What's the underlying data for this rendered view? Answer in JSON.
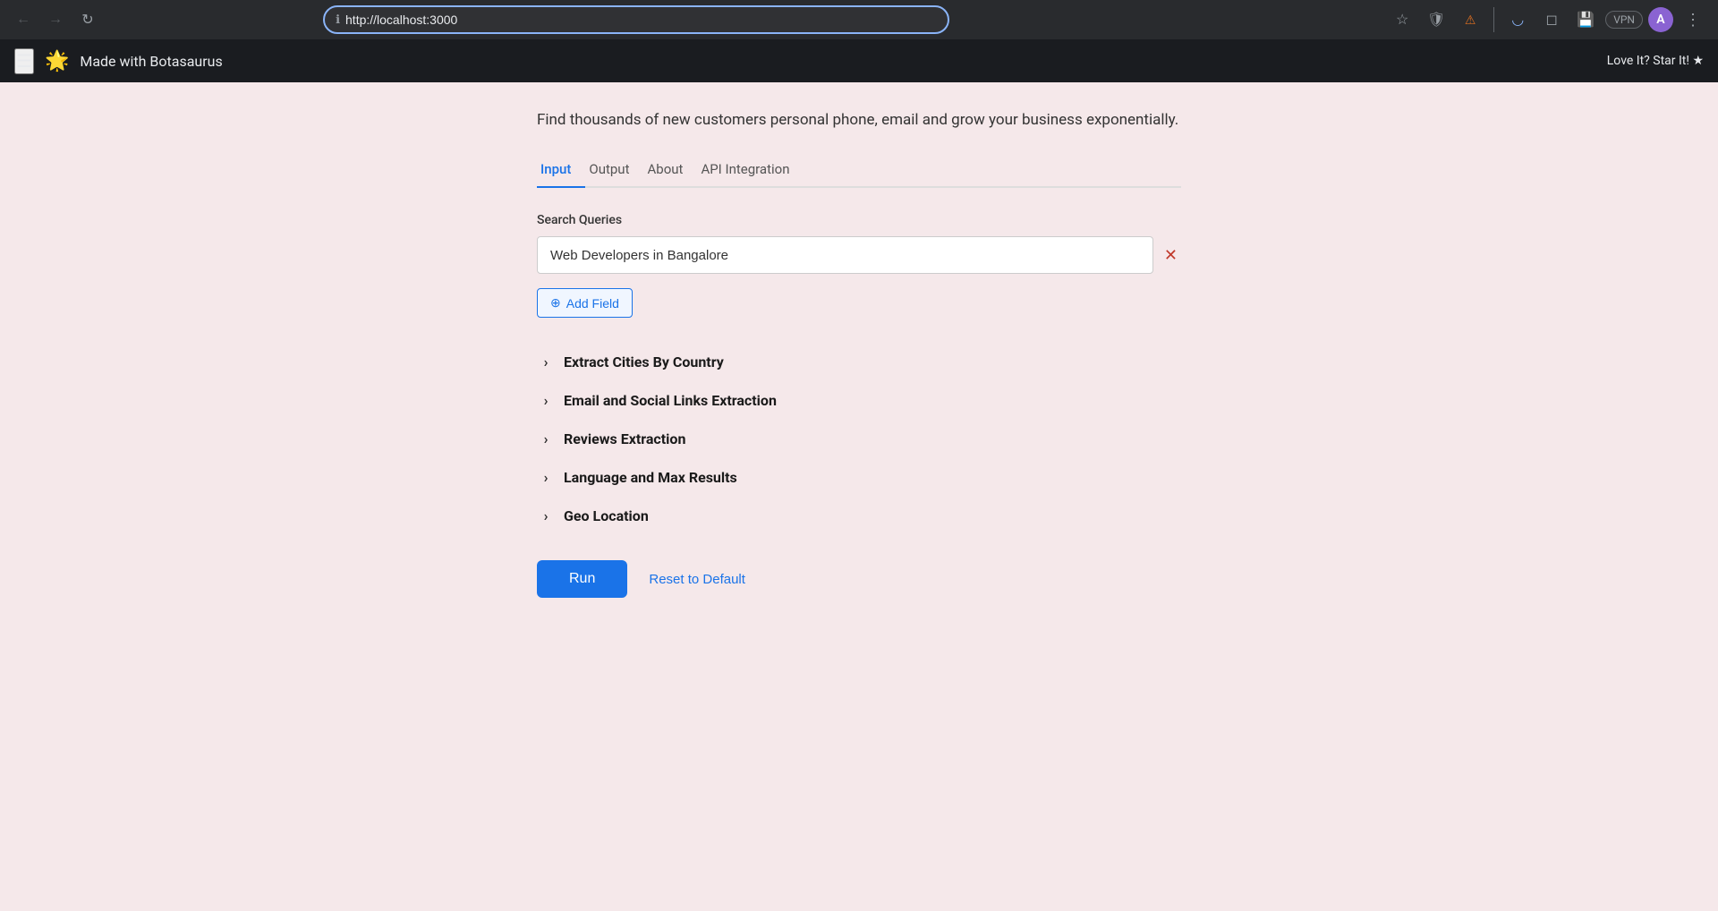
{
  "browser": {
    "url": "http://localhost:3000",
    "back_disabled": true,
    "forward_disabled": true
  },
  "app_header": {
    "title": "Made with Botasaurus",
    "logo_emoji": "🌟",
    "cta": "Love It? Star It! ★"
  },
  "tagline": "Find thousands of new customers personal phone, email and grow your business exponentially.",
  "tabs": [
    {
      "label": "Input",
      "active": true
    },
    {
      "label": "Output",
      "active": false
    },
    {
      "label": "About",
      "active": false
    },
    {
      "label": "API Integration",
      "active": false
    }
  ],
  "search_queries": {
    "label": "Search Queries",
    "placeholder": "Web Developers in Bangalore",
    "value": "Web Developers in Bangalore"
  },
  "add_field_btn": "+ Add Field",
  "accordion_sections": [
    {
      "title": "Extract Cities By Country"
    },
    {
      "title": "Email and Social Links Extraction"
    },
    {
      "title": "Reviews Extraction"
    },
    {
      "title": "Language and Max Results"
    },
    {
      "title": "Geo Location"
    }
  ],
  "buttons": {
    "run_label": "Run",
    "reset_label": "Reset to Default"
  }
}
